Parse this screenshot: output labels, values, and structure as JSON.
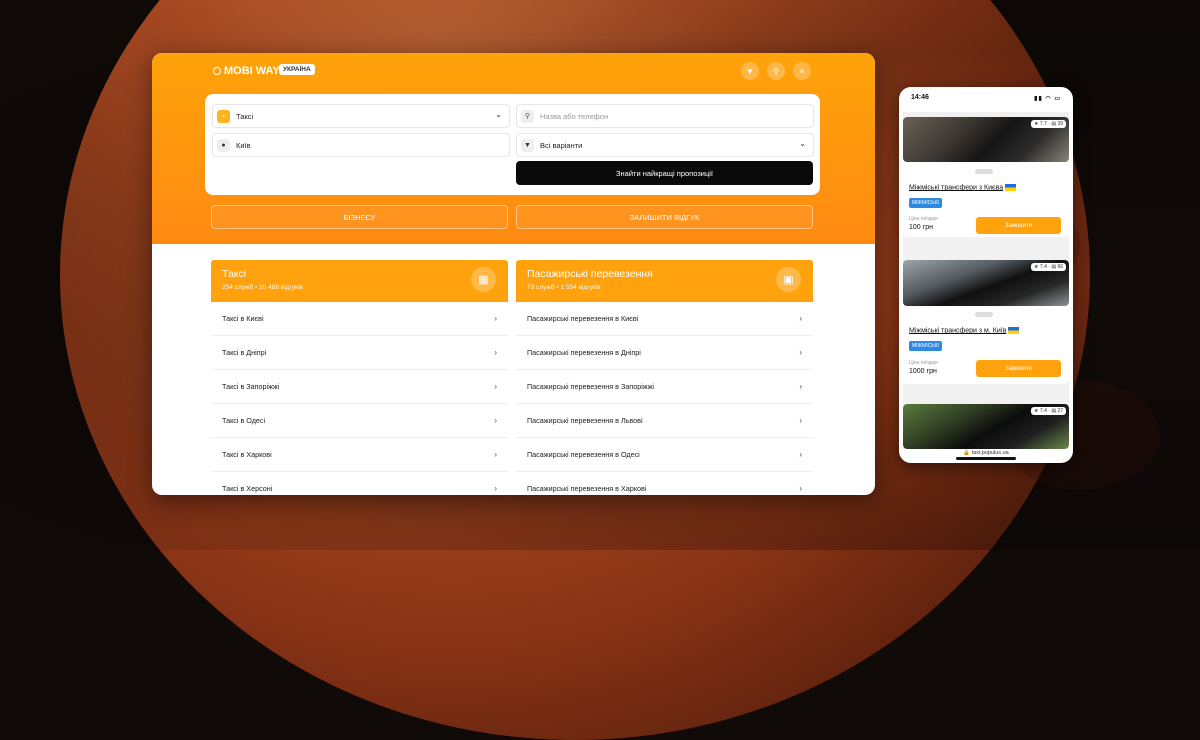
{
  "colors": {
    "accent": "#ffa20d",
    "dark": "#0a0a0a",
    "tag": "#2e8ae0"
  },
  "header": {
    "logo": "MOBI WAY",
    "country_badge": "УКРАЇНА",
    "icons": [
      "filter-icon",
      "search-icon",
      "menu-icon"
    ]
  },
  "search": {
    "service": "Таксі",
    "city": "Київ",
    "name_placeholder": "Назва або телефон",
    "filter": "Всі варіанти",
    "submit": "Знайти найкращі пропозиції"
  },
  "actions": {
    "business": "БІЗНЕСУ",
    "feedback": "ЗАЛИШИТИ ВІДГУК"
  },
  "columns": [
    {
      "title": "Таксі",
      "services": "254 служб",
      "reviews": "20 488 відгуків",
      "items": [
        "Таксі в Києві",
        "Таксі в Дніпрі",
        "Таксі в Запоріжжі",
        "Таксі в Одесі",
        "Таксі в Харкові",
        "Таксі в Херсоні"
      ]
    },
    {
      "title": "Пасажирські перевезення",
      "services": "73 служб",
      "reviews": "1 554 відгуків",
      "items": [
        "Пасажирські перевезення в Києві",
        "Пасажирські перевезення в Дніпрі",
        "Пасажирські перевезення в Запоріжжі",
        "Пасажирські перевезення в Львові",
        "Пасажирські перевезення в Одесі",
        "Пасажирські перевезення в Харкові"
      ]
    }
  ],
  "phone": {
    "time": "14:46",
    "url": "taxi.populus.ua",
    "cards": [
      {
        "rating": "7.7",
        "reviews": "39",
        "title": "Міжміські трансфери з Києва",
        "tag": "МІЖМІСЬКІ",
        "price_label": "Ціна поїздки",
        "price": "100",
        "currency": "грн",
        "button": "Замовити"
      },
      {
        "rating": "7.4",
        "reviews": "66",
        "title": "Міжміські трансфери з м. Київ",
        "tag": "МІЖМІСЬКІ",
        "price_label": "Ціна поїздки",
        "price": "1000",
        "currency": "грн",
        "button": "Замовити"
      },
      {
        "rating": "7.4",
        "reviews": "27"
      }
    ]
  }
}
